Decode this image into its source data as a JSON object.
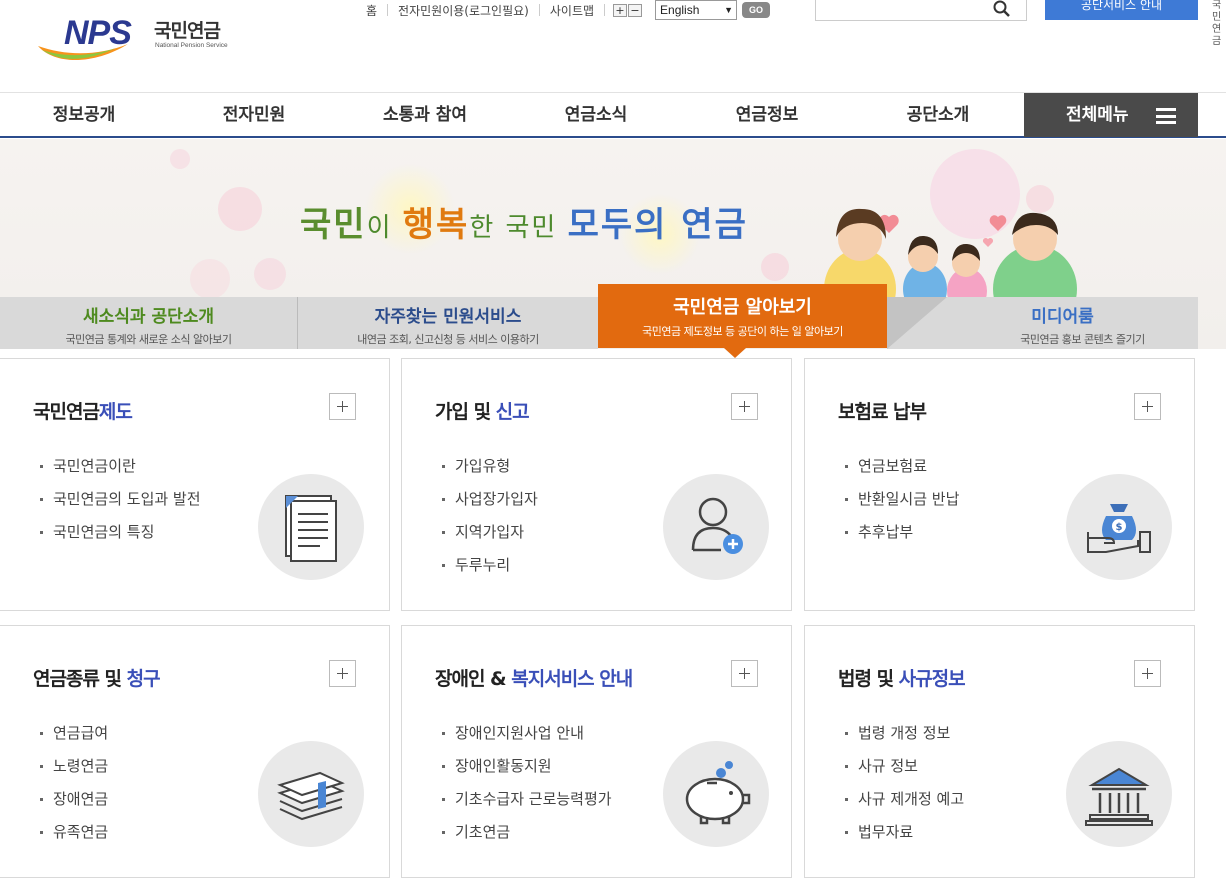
{
  "header": {
    "logo": {
      "mark": "NPS",
      "name_ko": "국민연금",
      "name_en": "National Pension Service"
    },
    "util_links": [
      "홈",
      "전자민원이용(로그인필요)",
      "사이트맵"
    ],
    "zoom": {
      "in": "+",
      "out": "−"
    },
    "language": {
      "selected": "English"
    },
    "go_label": "GO",
    "search": {
      "placeholder": ""
    },
    "blue_button": "공단서비스 안내",
    "side_tab": "국민연금"
  },
  "gnb": {
    "items": [
      "정보공개",
      "전자민원",
      "소통과 참여",
      "연금소식",
      "연금정보",
      "공단소개"
    ],
    "all_menu": "전체메뉴"
  },
  "banner": {
    "slogan": {
      "w1": "국민",
      "w2": "이 ",
      "w3": "행복",
      "w4": "한 국민 ",
      "w5": "모두의 연금"
    }
  },
  "tabs": [
    {
      "title": "새소식과 공단소개",
      "desc": "국민연금 통계와 새로운 소식 알아보기"
    },
    {
      "title": "자주찾는 민원서비스",
      "desc": "내연금 조회, 신고신청 등 서비스 이용하기"
    },
    {
      "title": "국민연금 알아보기",
      "desc": "국민연금 제도정보 등 공단이 하는 일 알아보기"
    },
    {
      "title": "미디어룸",
      "desc": "국민연금 홍보 콘텐츠 즐기기"
    }
  ],
  "cards": [
    {
      "title_a": "국민연금",
      "title_b": "제도",
      "icon": "document-icon",
      "items": [
        "국민연금이란",
        "국민연금의 도입과 발전",
        "국민연금의 특징"
      ]
    },
    {
      "title_a": "가입 및 ",
      "title_b": "신고",
      "icon": "user-add-icon",
      "items": [
        "가입유형",
        "사업장가입자",
        "지역가입자",
        "두루누리"
      ]
    },
    {
      "title_a": "보험료 납부",
      "title_b": "",
      "icon": "money-bag-icon",
      "items": [
        "연금보험료",
        "반환일시금 반납",
        "추후납부"
      ]
    },
    {
      "title_a": "연금종류 및 ",
      "title_b": "청구",
      "icon": "money-stack-icon",
      "items": [
        "연금급여",
        "노령연금",
        "장애연금",
        "유족연금"
      ]
    },
    {
      "title_a": "장애인 & ",
      "title_b": "복지서비스 안내",
      "icon": "piggy-bank-icon",
      "items": [
        "장애인지원사업 안내",
        "장애인활동지원",
        "기초수급자 근로능력평가",
        "기초연금"
      ]
    },
    {
      "title_a": "법령 및 ",
      "title_b": "사규정보",
      "icon": "building-icon",
      "items": [
        "법령 개정 정보",
        "사규 정보",
        "사규 제개정 예고",
        "법무자료"
      ]
    }
  ]
}
